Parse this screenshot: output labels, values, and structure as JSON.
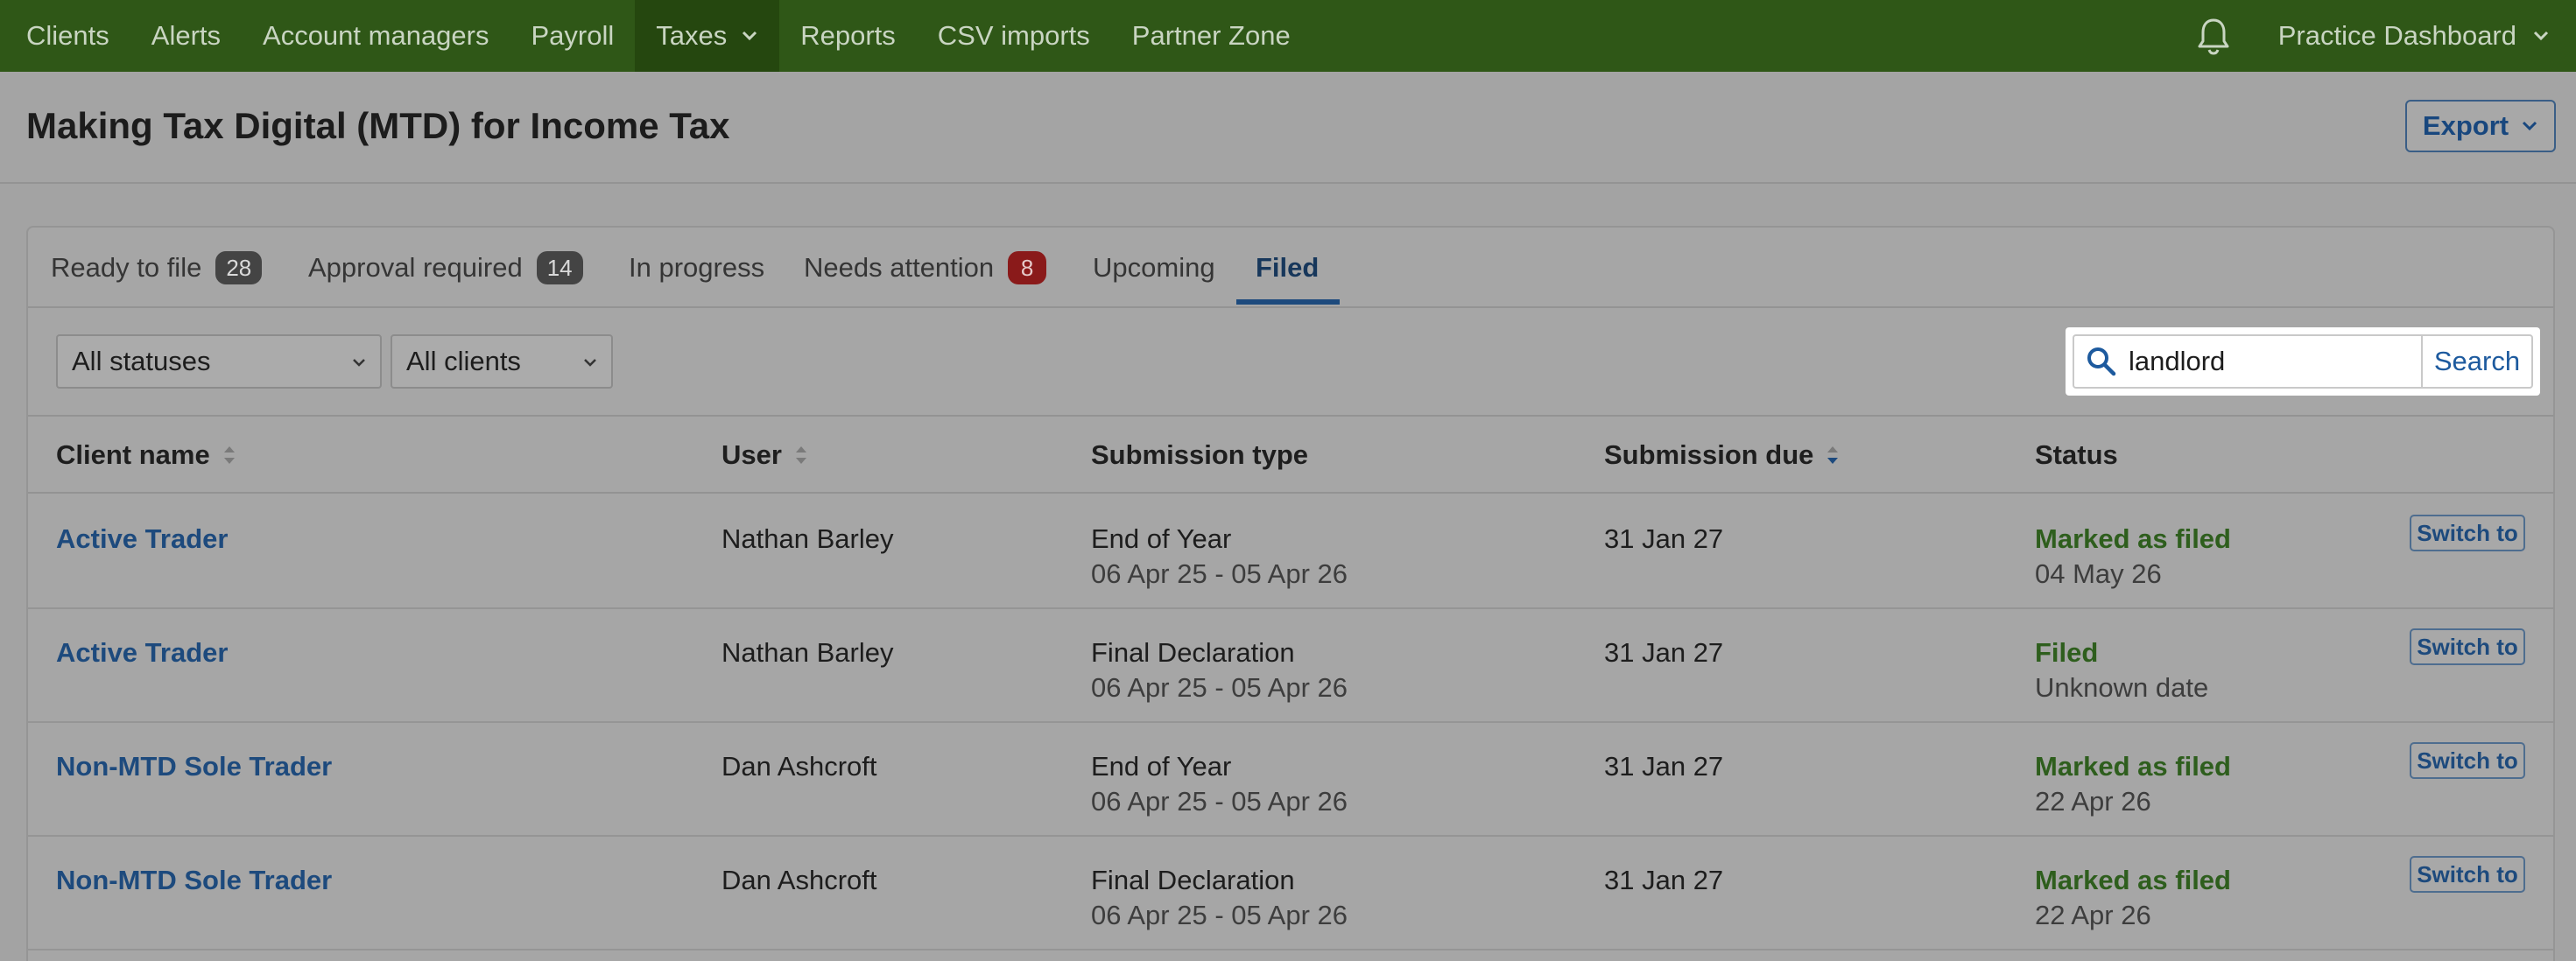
{
  "nav": {
    "items": [
      {
        "label": "Clients"
      },
      {
        "label": "Alerts"
      },
      {
        "label": "Account managers"
      },
      {
        "label": "Payroll"
      },
      {
        "label": "Taxes",
        "active": true
      },
      {
        "label": "Reports"
      },
      {
        "label": "CSV imports"
      },
      {
        "label": "Partner Zone"
      }
    ],
    "practice_label": "Practice Dashboard"
  },
  "header": {
    "title": "Making Tax Digital (MTD) for Income Tax",
    "export_label": "Export"
  },
  "tabs": [
    {
      "label": "Ready to file",
      "badge": "28"
    },
    {
      "label": "Approval required",
      "badge": "14"
    },
    {
      "label": "In progress"
    },
    {
      "label": "Needs attention",
      "badge": "8"
    },
    {
      "label": "Upcoming"
    },
    {
      "label": "Filed",
      "active": true
    }
  ],
  "filters": {
    "status_selected": "All statuses",
    "clients_selected": "All clients",
    "search_value": "landlord",
    "search_button": "Search"
  },
  "table": {
    "columns": [
      "Client name",
      "User",
      "Submission type",
      "Submission due",
      "Status"
    ],
    "switch_label": "Switch to",
    "rows": [
      {
        "client": "Active Trader",
        "user": "Nathan Barley",
        "type": "End of Year",
        "period": "06 Apr 25 - 05 Apr 26",
        "due": "31 Jan 27",
        "status": "Marked as filed",
        "status_date": "04 May 26"
      },
      {
        "client": "Active Trader",
        "user": "Nathan Barley",
        "type": "Final Declaration",
        "period": "06 Apr 25 - 05 Apr 26",
        "due": "31 Jan 27",
        "status": "Filed",
        "status_date": "Unknown date"
      },
      {
        "client": "Non-MTD Sole Trader",
        "user": "Dan Ashcroft",
        "type": "End of Year",
        "period": "06 Apr 25 - 05 Apr 26",
        "due": "31 Jan 27",
        "status": "Marked as filed",
        "status_date": "22 Apr 26"
      },
      {
        "client": "Non-MTD Sole Trader",
        "user": "Dan Ashcroft",
        "type": "Final Declaration",
        "period": "06 Apr 25 - 05 Apr 26",
        "due": "31 Jan 27",
        "status": "Marked as filed",
        "status_date": "22 Apr 26"
      }
    ]
  }
}
